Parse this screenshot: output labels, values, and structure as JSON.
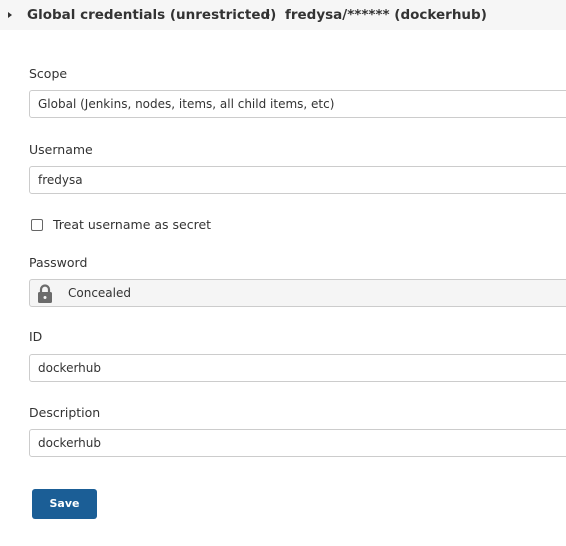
{
  "breadcrumb": {
    "items": [
      {
        "label": "Global credentials (unrestricted)"
      },
      {
        "label": "fredysa/****** (dockerhub)"
      }
    ]
  },
  "form": {
    "scope": {
      "label": "Scope",
      "value": "Global (Jenkins, nodes, items, all child items, etc)"
    },
    "username": {
      "label": "Username",
      "value": "fredysa"
    },
    "treat_secret": {
      "label": "Treat username as secret",
      "checked": false
    },
    "password": {
      "label": "Password",
      "value": "Concealed",
      "icon": "lock-icon"
    },
    "id": {
      "label": "ID",
      "value": "dockerhub"
    },
    "description": {
      "label": "Description",
      "value": "dockerhub"
    }
  },
  "actions": {
    "save_label": "Save"
  },
  "colors": {
    "primary": "#1b5e96",
    "breadcrumb_bg": "#f6f6f6",
    "field_border": "#cccccc"
  }
}
